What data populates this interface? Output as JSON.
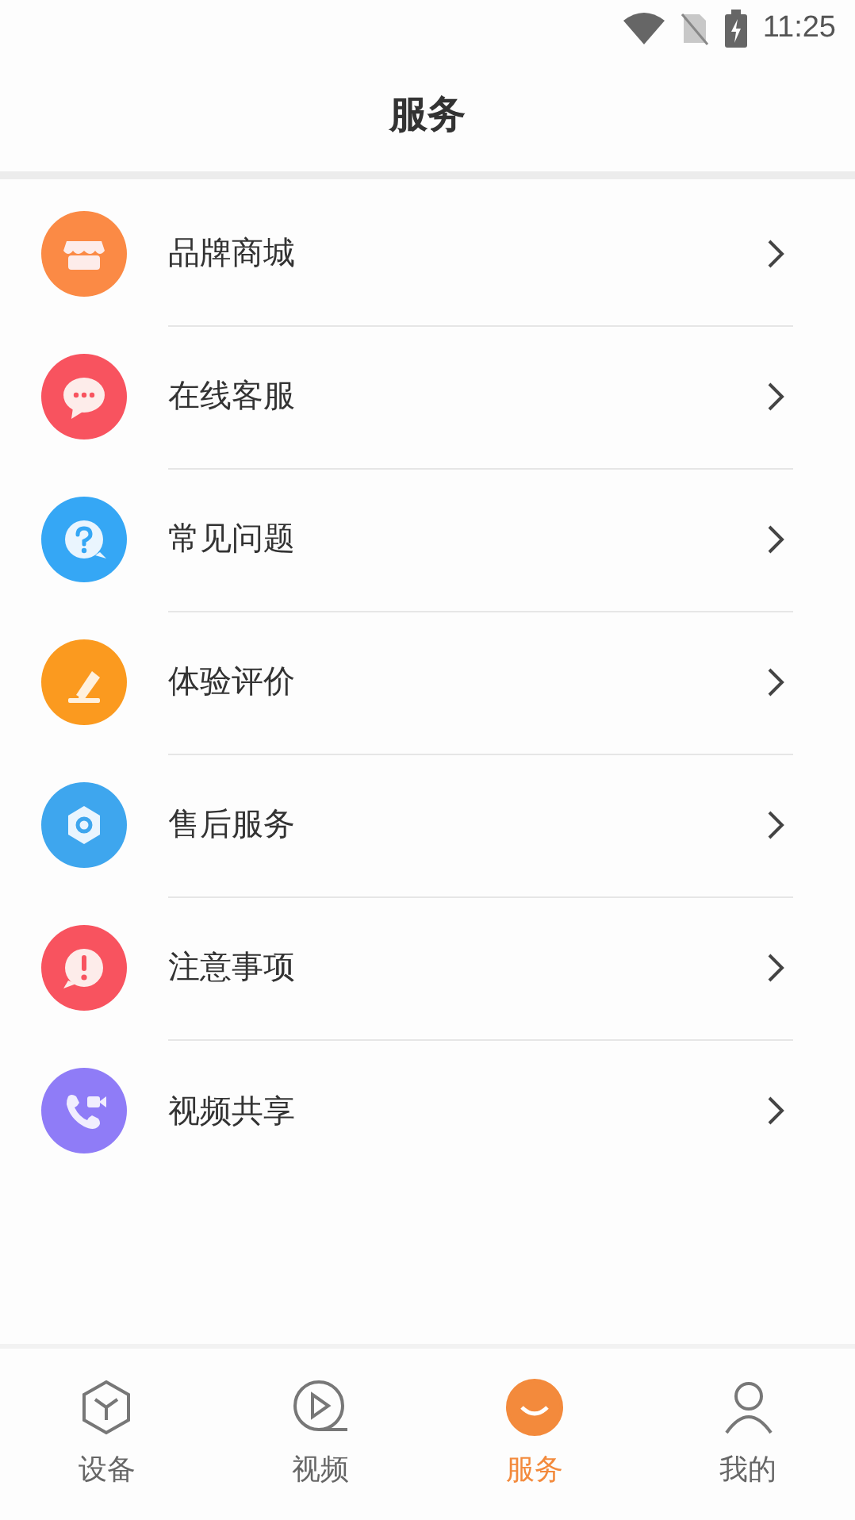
{
  "status_bar": {
    "time": "11:25"
  },
  "header": {
    "title": "服务"
  },
  "services": [
    {
      "label": "品牌商城",
      "kind": "store",
      "color": "#fb8a45"
    },
    {
      "label": "在线客服",
      "kind": "chat",
      "color": "#f8535f"
    },
    {
      "label": "常见问题",
      "kind": "question",
      "color": "#35a7f5"
    },
    {
      "label": "体验评价",
      "kind": "edit",
      "color": "#fb9a1f"
    },
    {
      "label": "售后服务",
      "kind": "settings",
      "color": "#3ea6ee"
    },
    {
      "label": "注意事项",
      "kind": "alert",
      "color": "#f8535f"
    },
    {
      "label": "视频共享",
      "kind": "call",
      "color": "#8f7cf7"
    }
  ],
  "tab_bar": [
    {
      "label": "设备",
      "kind": "device",
      "selected": false
    },
    {
      "label": "视频",
      "kind": "video",
      "selected": false
    },
    {
      "label": "服务",
      "kind": "service",
      "selected": true
    },
    {
      "label": "我的",
      "kind": "profile",
      "selected": false
    }
  ]
}
